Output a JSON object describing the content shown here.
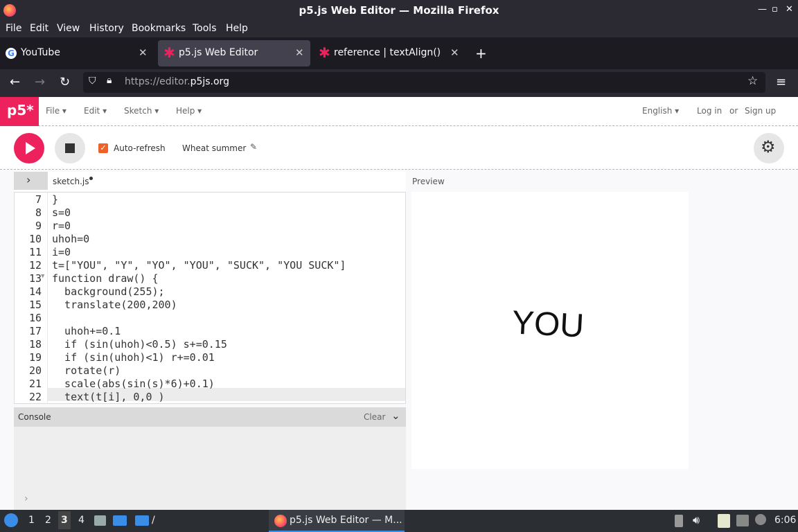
{
  "window": {
    "title": "p5.js Web Editor — Mozilla Firefox"
  },
  "menubar": [
    "File",
    "Edit",
    "View",
    "History",
    "Bookmarks",
    "Tools",
    "Help"
  ],
  "tabs": [
    {
      "label": "YouTube"
    },
    {
      "label": "p5.js Web Editor"
    },
    {
      "label": "reference | textAlign()"
    }
  ],
  "url": {
    "prefix": "https://editor.",
    "host": "p5js.org"
  },
  "p5nav": {
    "logo": "p5*",
    "menus": [
      "File",
      "Edit",
      "Sketch",
      "Help"
    ],
    "language": "English",
    "login": "Log in",
    "or": "or",
    "signup": "Sign up"
  },
  "toolbar": {
    "autorefresh_label": "Auto-refresh",
    "sketch_name": "Wheat summer"
  },
  "editor": {
    "filename": "sketch.js",
    "lines": [
      {
        "n": "7",
        "code": "}"
      },
      {
        "n": "8",
        "code": "s=0"
      },
      {
        "n": "9",
        "code": "r=0"
      },
      {
        "n": "10",
        "code": "uhoh=0"
      },
      {
        "n": "11",
        "code": "i=0"
      },
      {
        "n": "12",
        "code": "t=[\"YOU\", \"Y\", \"YO\", \"YOU\", \"SUCK\", \"YOU SUCK\"]"
      },
      {
        "n": "13",
        "code": "function draw() {"
      },
      {
        "n": "14",
        "code": "  background(255);"
      },
      {
        "n": "15",
        "code": "  translate(200,200)"
      },
      {
        "n": "16",
        "code": ""
      },
      {
        "n": "17",
        "code": "  uhoh+=0.1"
      },
      {
        "n": "18",
        "code": "  if (sin(uhoh)<0.5) s+=0.15"
      },
      {
        "n": "19",
        "code": "  if (sin(uhoh)<1) r+=0.01"
      },
      {
        "n": "20",
        "code": "  rotate(r)"
      },
      {
        "n": "21",
        "code": "  scale(abs(sin(s)*6)+0.1)"
      },
      {
        "n": "22",
        "code": "  text(t[i], 0,0 )"
      }
    ]
  },
  "console": {
    "label": "Console",
    "clear": "Clear",
    "prompt": "›"
  },
  "preview": {
    "label": "Preview",
    "text": "YOU"
  },
  "taskbar": {
    "workspaces": [
      "1",
      "2",
      "3",
      "4"
    ],
    "window_label": "p5.js Web Editor — M...",
    "clock": "6:06"
  }
}
